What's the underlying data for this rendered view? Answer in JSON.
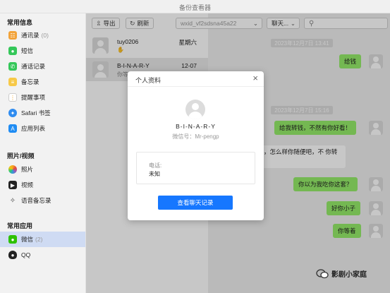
{
  "window": {
    "title": "备份查看器"
  },
  "sidebar": {
    "sections": [
      {
        "title": "常用信息",
        "items": [
          {
            "label": "通讯录",
            "count": "(0)",
            "icon": "contacts-icon",
            "color": "#f2a33a"
          },
          {
            "label": "短信",
            "count": "",
            "icon": "message-icon",
            "color": "#34c759"
          },
          {
            "label": "通话记录",
            "count": "",
            "icon": "phone-icon",
            "color": "#34c759"
          },
          {
            "label": "备忘录",
            "count": "",
            "icon": "notes-icon",
            "color": "#f7c948"
          },
          {
            "label": "提醒事项",
            "count": "",
            "icon": "reminders-icon",
            "color": "#ffffff"
          },
          {
            "label": "Safari 书签",
            "count": "",
            "icon": "safari-icon",
            "color": "#2f8cf0"
          },
          {
            "label": "应用列表",
            "count": "",
            "icon": "appstore-icon",
            "color": "#1f8cf3"
          }
        ]
      },
      {
        "title": "照片/视频",
        "items": [
          {
            "label": "照片",
            "count": "",
            "icon": "photos-icon",
            "color": "#f5a623"
          },
          {
            "label": "视频",
            "count": "",
            "icon": "video-icon",
            "color": "#222222"
          },
          {
            "label": "语音备忘录",
            "count": "",
            "icon": "voice-memo-icon",
            "color": "#444444"
          }
        ]
      },
      {
        "title": "常用应用",
        "items": [
          {
            "label": "微信",
            "count": "(2)",
            "icon": "wechat-icon",
            "color": "#2dc100"
          },
          {
            "label": "QQ",
            "count": "",
            "icon": "qq-icon",
            "color": "#222222"
          }
        ]
      }
    ]
  },
  "toolbar": {
    "export_label": "导出",
    "refresh_label": "刷新"
  },
  "contacts": [
    {
      "name": "tuy0206",
      "date": "星期六",
      "preview": "✋"
    },
    {
      "name": "B-I-N-A-R-Y",
      "date": "12-07",
      "preview": "你等着"
    }
  ],
  "chat": {
    "account_select": "wxid_vf2sdsna45a22",
    "filter_select": "聊天...",
    "messages": [
      {
        "type": "timestamp",
        "text": "2023年12月7日 13:41"
      },
      {
        "type": "me",
        "text": "给钱"
      },
      {
        "type": "timestamp",
        "text": "2023年12月7日 15:16"
      },
      {
        "type": "me",
        "text": "给我转钱，不然有你好看！"
      },
      {
        "type": "them",
        "text": "套了，怎么样你随便吧，不 你转了"
      },
      {
        "type": "me",
        "text": "你以为我吃你这套？"
      },
      {
        "type": "me",
        "text": "好你小子"
      },
      {
        "type": "me",
        "text": "你等着"
      }
    ]
  },
  "profile_modal": {
    "title": "个人资料",
    "name": "B-I-N-A-R-Y",
    "wechat_id": "微信号：Mr-pengp",
    "phone_label": "电话:",
    "phone_value": "未知",
    "button_label": "查看聊天记录"
  },
  "watermark": {
    "text": "影剧小家庭"
  }
}
